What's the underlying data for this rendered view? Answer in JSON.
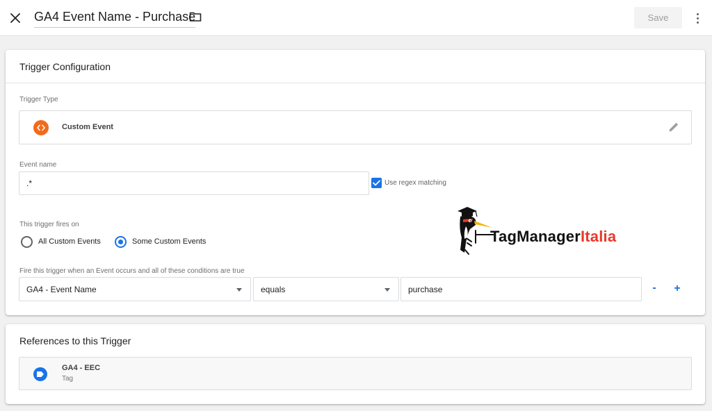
{
  "header": {
    "title": "GA4 Event Name - Purchase",
    "save_label": "Save"
  },
  "config": {
    "section_title": "Trigger Configuration",
    "trigger_type_label": "Trigger Type",
    "trigger_type_value": "Custom Event",
    "event_name_label": "Event name",
    "event_name_value": ".*",
    "regex_label": "Use regex matching",
    "regex_checked": true,
    "fires_on_label": "This trigger fires on",
    "radio_all": "All Custom Events",
    "radio_some": "Some Custom Events",
    "selected_option": "Some Custom Events",
    "conditions_label": "Fire this trigger when an Event occurs and all of these conditions are true",
    "condition": {
      "variable": "GA4 - Event Name",
      "operator": "equals",
      "value": "purchase"
    },
    "remove_label": "-",
    "add_label": "+"
  },
  "watermark": {
    "brand": "TagManager",
    "brand_accent": "Italia"
  },
  "references": {
    "section_title": "References to this Trigger",
    "items": [
      {
        "name": "GA4 - EEC",
        "type": "Tag"
      }
    ]
  },
  "colors": {
    "accent": "#1a73e8",
    "custom_event_icon": "#f26a1b",
    "logo_accent": "#e8392b"
  },
  "icons": [
    "close-icon",
    "folder-icon",
    "more-vert-icon",
    "code-icon",
    "pencil-icon",
    "check-icon",
    "tag-icon",
    "woodpecker-logo"
  ]
}
